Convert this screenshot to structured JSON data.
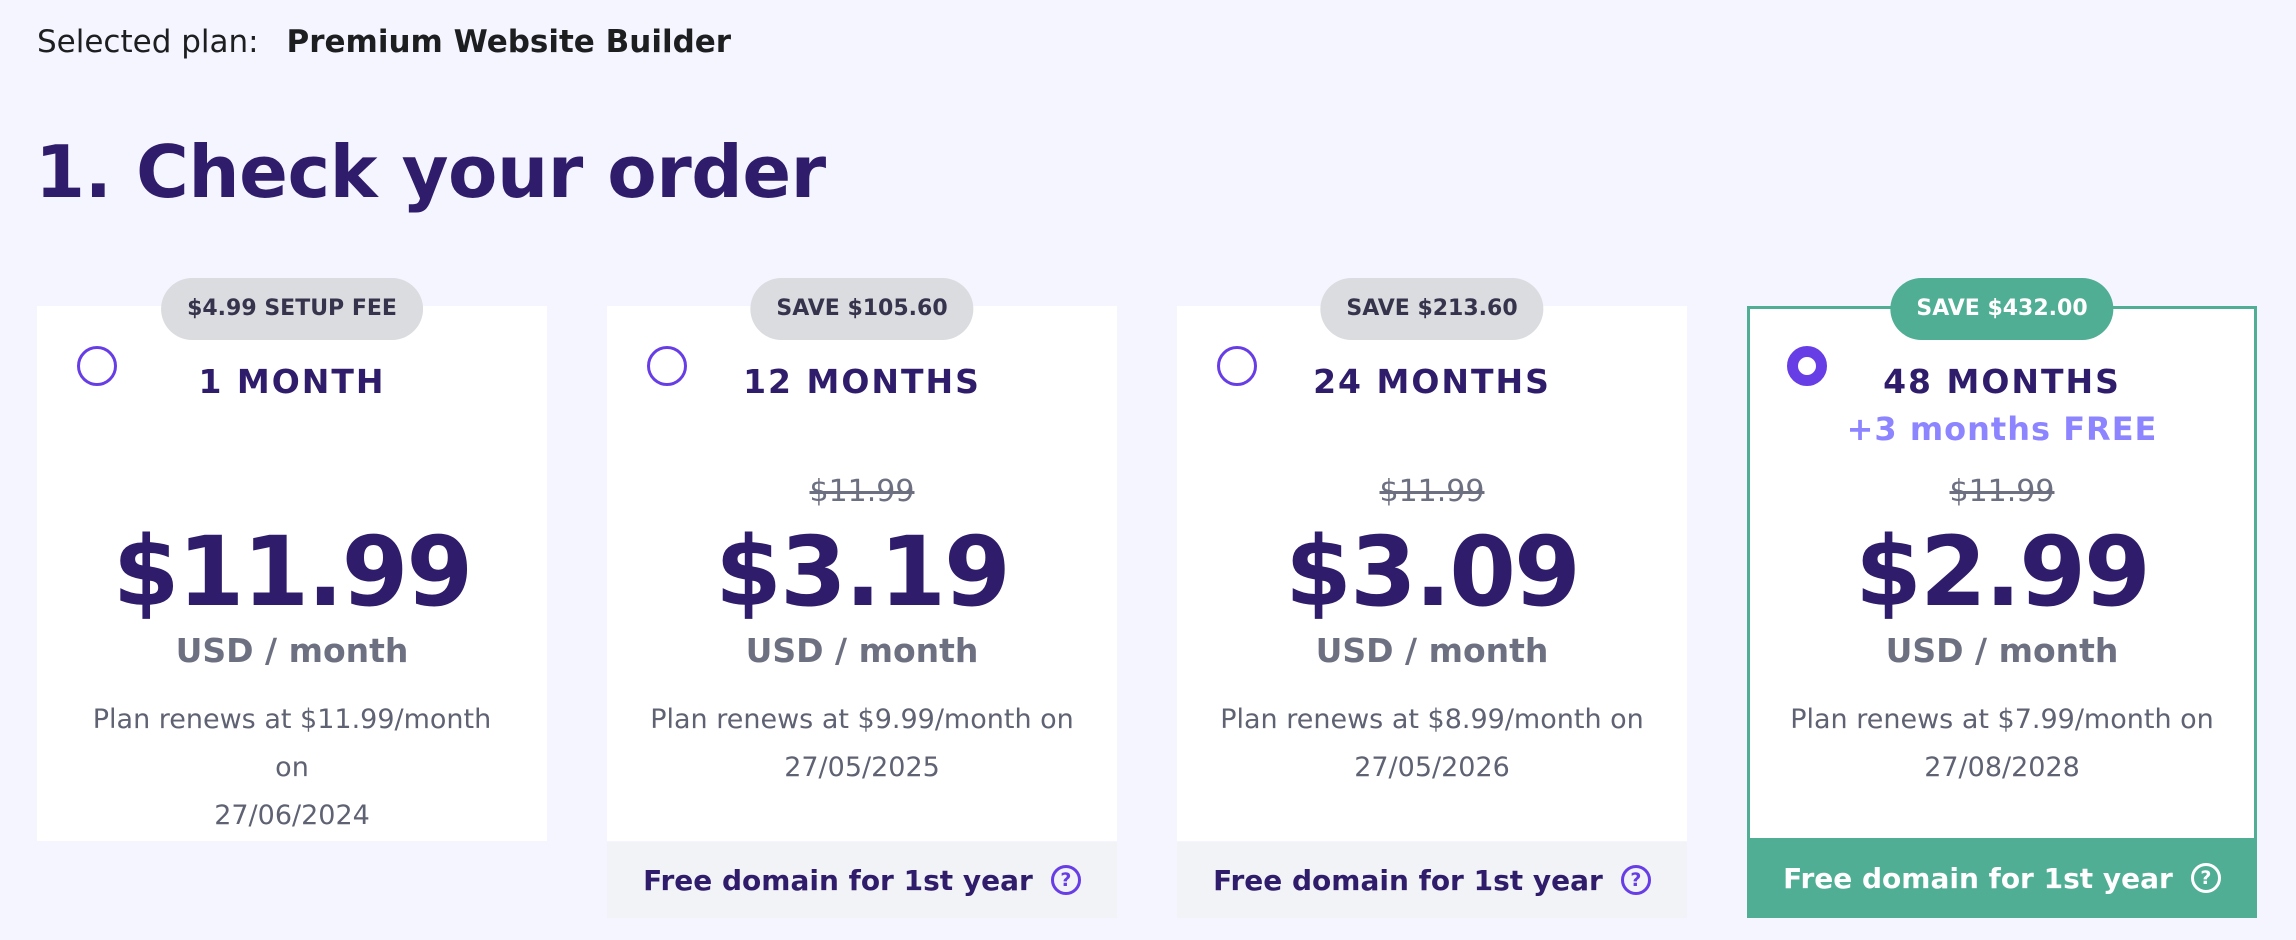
{
  "header": {
    "selected_plan_label": "Selected plan:",
    "selected_plan_value": "Premium Website Builder",
    "title": "1. Check your order"
  },
  "plans": [
    {
      "badge": "$4.99 SETUP FEE",
      "duration": "1 MONTH",
      "bonus": "",
      "old_price": "",
      "price": "$11.99",
      "unit": "USD / month",
      "renew_line1": "Plan renews at $11.99/month on",
      "renew_line2": "27/06/2024",
      "selected": false,
      "domain_text": ""
    },
    {
      "badge": "SAVE $105.60",
      "duration": "12 MONTHS",
      "bonus": "",
      "old_price": "$11.99",
      "price": "$3.19",
      "unit": "USD / month",
      "renew_line1": "Plan renews at $9.99/month on",
      "renew_line2": "27/05/2025",
      "selected": false,
      "domain_text": "Free domain for 1st year"
    },
    {
      "badge": "SAVE $213.60",
      "duration": "24 MONTHS",
      "bonus": "",
      "old_price": "$11.99",
      "price": "$3.09",
      "unit": "USD / month",
      "renew_line1": "Plan renews at $8.99/month on",
      "renew_line2": "27/05/2026",
      "selected": false,
      "domain_text": "Free domain for 1st year"
    },
    {
      "badge": "SAVE $432.00",
      "duration": "48 MONTHS",
      "bonus": "+3 months FREE",
      "old_price": "$11.99",
      "price": "$2.99",
      "unit": "USD / month",
      "renew_line1": "Plan renews at $7.99/month on",
      "renew_line2": "27/08/2028",
      "selected": true,
      "domain_text": "Free domain for 1st year"
    }
  ],
  "icons": {
    "help": "question-circle",
    "radio": "radio-button"
  },
  "colors": {
    "accent": "#673de6",
    "selected": "#4fae93",
    "title": "#2f1c6a",
    "bonus": "#8c85ff",
    "background": "#f4f5ff"
  }
}
